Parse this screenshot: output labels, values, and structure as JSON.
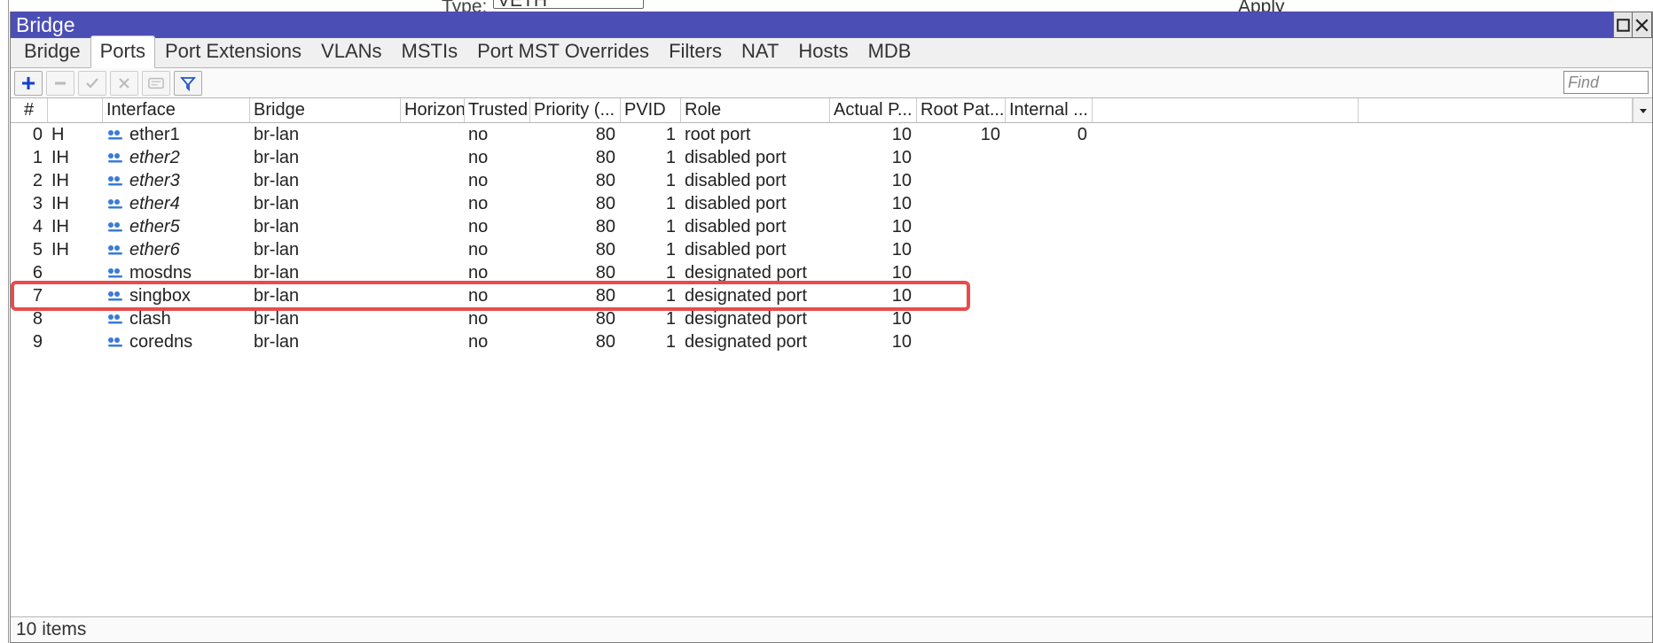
{
  "background": {
    "type_label": "Type:",
    "type_value": "VETH",
    "apply_label": "Apply"
  },
  "window": {
    "title": "Bridge"
  },
  "tabs": [
    "Bridge",
    "Ports",
    "Port Extensions",
    "VLANs",
    "MSTIs",
    "Port MST Overrides",
    "Filters",
    "NAT",
    "Hosts",
    "MDB"
  ],
  "active_tab_index": 1,
  "find_placeholder": "Find",
  "columns": [
    "#",
    "",
    "Interface",
    "Bridge",
    "Horizon",
    "Trusted",
    "Priority (...",
    "PVID",
    "Role",
    "Actual P...",
    "Root Pat...",
    "Internal ..."
  ],
  "highlight_row_index": 7,
  "rows": [
    {
      "num": "0",
      "flag": "H",
      "iface": "ether1",
      "italic": false,
      "bridge": "br-lan",
      "horizon": "",
      "trusted": "no",
      "prio": "80",
      "pvid": "1",
      "role": "root port",
      "actualp": "10",
      "rootpat": "10",
      "internal": "0"
    },
    {
      "num": "1",
      "flag": "IH",
      "iface": "ether2",
      "italic": true,
      "bridge": "br-lan",
      "horizon": "",
      "trusted": "no",
      "prio": "80",
      "pvid": "1",
      "role": "disabled port",
      "actualp": "10",
      "rootpat": "",
      "internal": ""
    },
    {
      "num": "2",
      "flag": "IH",
      "iface": "ether3",
      "italic": true,
      "bridge": "br-lan",
      "horizon": "",
      "trusted": "no",
      "prio": "80",
      "pvid": "1",
      "role": "disabled port",
      "actualp": "10",
      "rootpat": "",
      "internal": ""
    },
    {
      "num": "3",
      "flag": "IH",
      "iface": "ether4",
      "italic": true,
      "bridge": "br-lan",
      "horizon": "",
      "trusted": "no",
      "prio": "80",
      "pvid": "1",
      "role": "disabled port",
      "actualp": "10",
      "rootpat": "",
      "internal": ""
    },
    {
      "num": "4",
      "flag": "IH",
      "iface": "ether5",
      "italic": true,
      "bridge": "br-lan",
      "horizon": "",
      "trusted": "no",
      "prio": "80",
      "pvid": "1",
      "role": "disabled port",
      "actualp": "10",
      "rootpat": "",
      "internal": ""
    },
    {
      "num": "5",
      "flag": "IH",
      "iface": "ether6",
      "italic": true,
      "bridge": "br-lan",
      "horizon": "",
      "trusted": "no",
      "prio": "80",
      "pvid": "1",
      "role": "disabled port",
      "actualp": "10",
      "rootpat": "",
      "internal": ""
    },
    {
      "num": "6",
      "flag": "",
      "iface": "mosdns",
      "italic": false,
      "bridge": "br-lan",
      "horizon": "",
      "trusted": "no",
      "prio": "80",
      "pvid": "1",
      "role": "designated port",
      "actualp": "10",
      "rootpat": "",
      "internal": ""
    },
    {
      "num": "7",
      "flag": "",
      "iface": "singbox",
      "italic": false,
      "bridge": "br-lan",
      "horizon": "",
      "trusted": "no",
      "prio": "80",
      "pvid": "1",
      "role": "designated port",
      "actualp": "10",
      "rootpat": "",
      "internal": ""
    },
    {
      "num": "8",
      "flag": "",
      "iface": "clash",
      "italic": false,
      "bridge": "br-lan",
      "horizon": "",
      "trusted": "no",
      "prio": "80",
      "pvid": "1",
      "role": "designated port",
      "actualp": "10",
      "rootpat": "",
      "internal": ""
    },
    {
      "num": "9",
      "flag": "",
      "iface": "coredns",
      "italic": false,
      "bridge": "br-lan",
      "horizon": "",
      "trusted": "no",
      "prio": "80",
      "pvid": "1",
      "role": "designated port",
      "actualp": "10",
      "rootpat": "",
      "internal": ""
    }
  ],
  "status": "10 items"
}
